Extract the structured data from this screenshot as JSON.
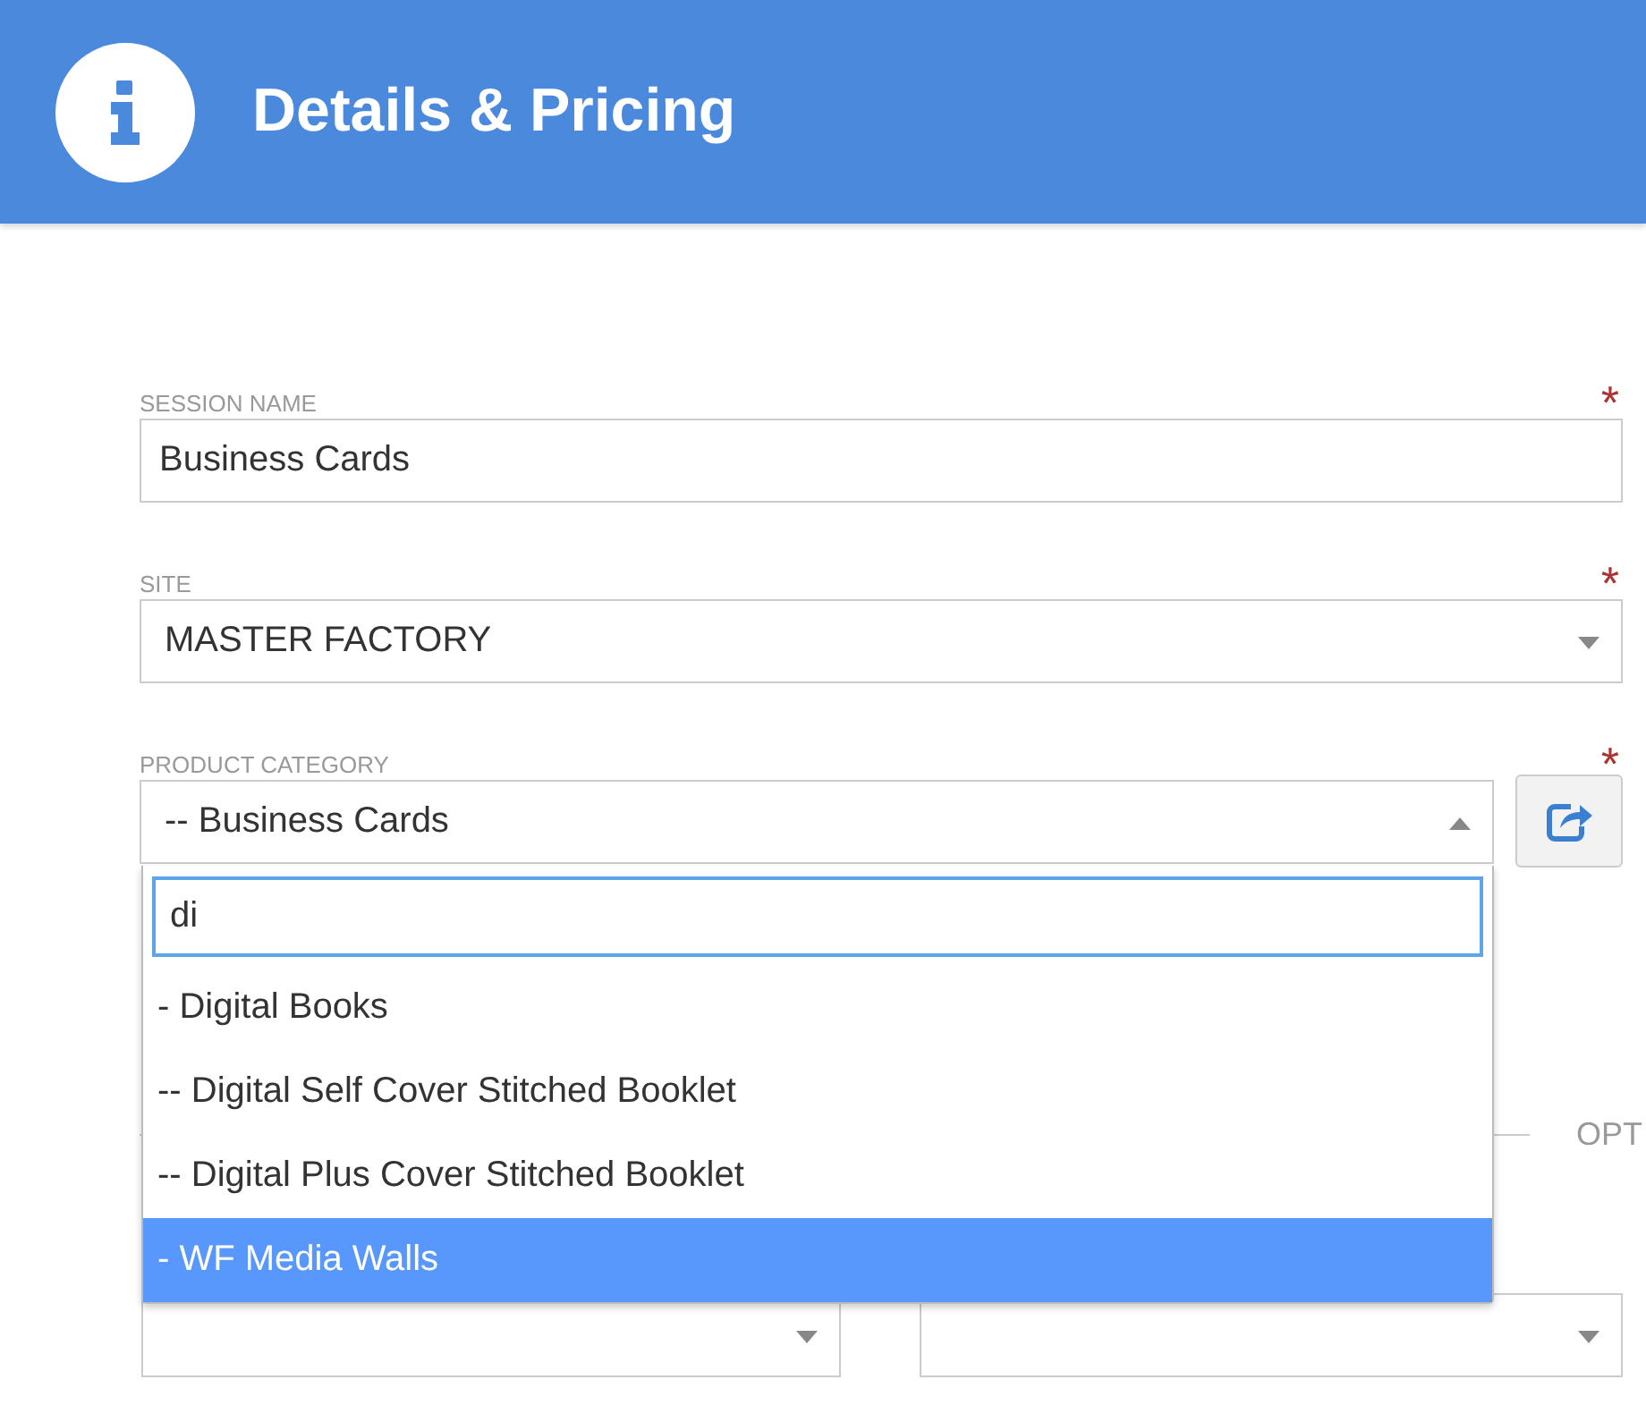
{
  "header": {
    "title": "Details & Pricing"
  },
  "fields": [
    {
      "label": "SESSION NAME",
      "kind": "text",
      "value": "Business Cards",
      "required_mark": "*"
    },
    {
      "label": "SITE",
      "kind": "select",
      "value": "MASTER FACTORY",
      "required_mark": "*",
      "expanded": false
    },
    {
      "label": "PRODUCT CATEGORY",
      "kind": "select",
      "value": "-- Business Cards",
      "required_mark": "*",
      "expanded": true,
      "action": true,
      "dropdown": {
        "search": "di",
        "options": [
          {
            "label": "- Digital Books",
            "selected": false
          },
          {
            "label": "-- Digital Self Cover Stitched Booklet",
            "selected": false
          },
          {
            "label": "-- Digital Plus Cover Stitched Booklet",
            "selected": false
          },
          {
            "label": "- WF Media Walls",
            "selected": true
          }
        ]
      }
    }
  ],
  "section": {
    "title": "OPT"
  },
  "lower_selects": [
    {
      "kind": "select"
    },
    {
      "kind": "select"
    }
  ]
}
